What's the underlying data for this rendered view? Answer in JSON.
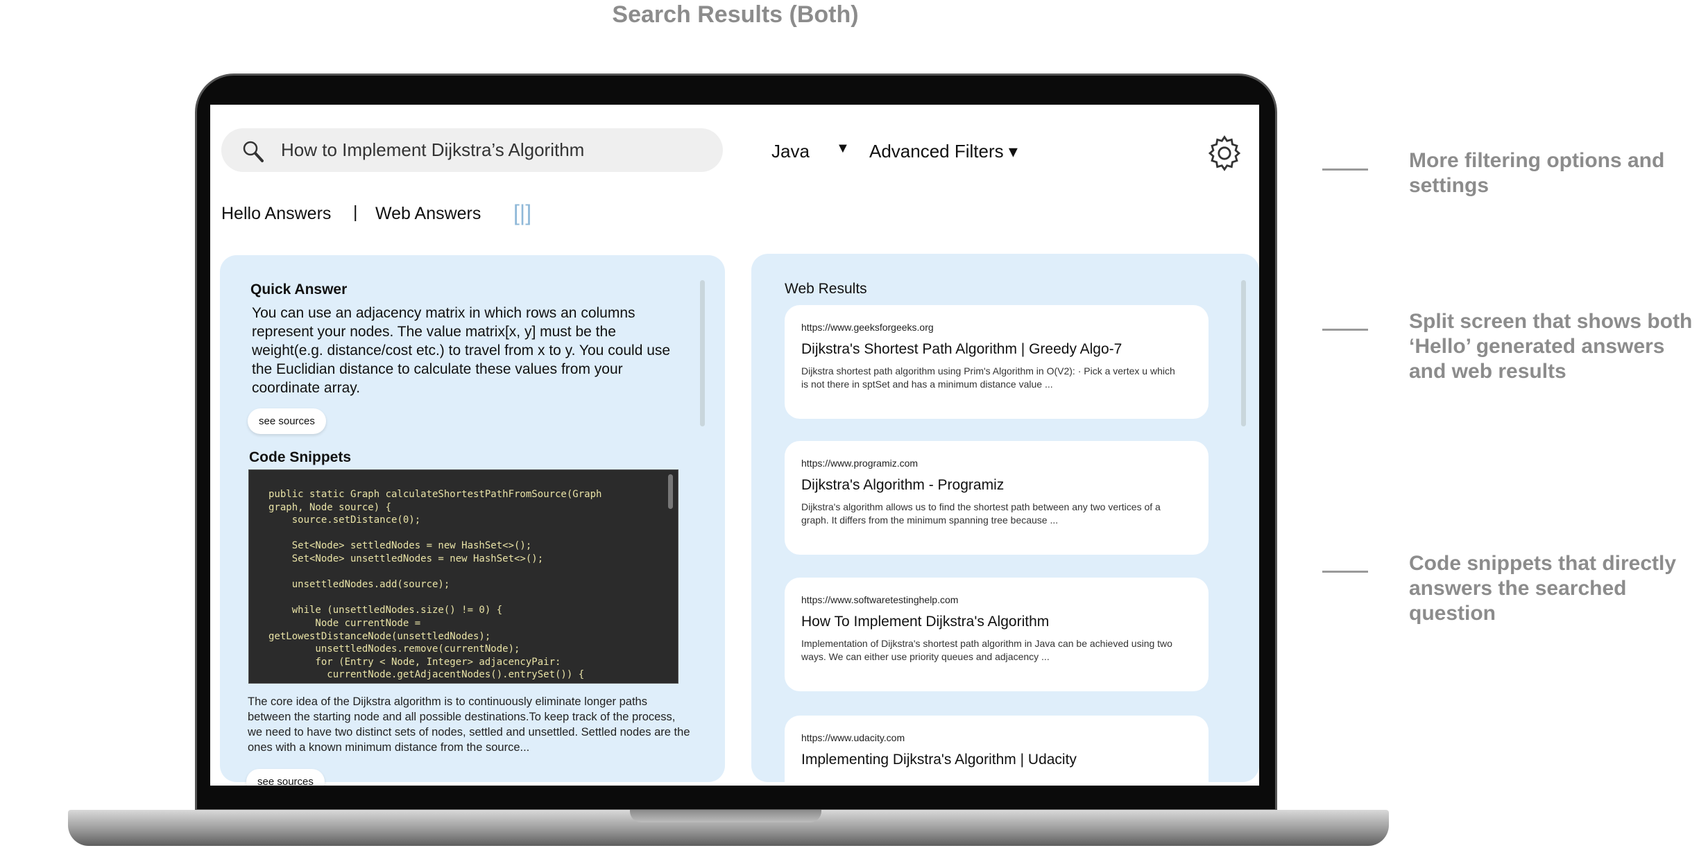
{
  "page_title": "Search Results (Both)",
  "search": {
    "query": "How to Implement Dijkstra’s Algorithm"
  },
  "filters": {
    "language": "Java",
    "advanced": "Advanced Filters ▾"
  },
  "tabs": {
    "hello": "Hello Answers",
    "separator": "|",
    "web": "Web Answers",
    "split_icon": "[|]"
  },
  "left": {
    "quick_answer_heading": "Quick Answer",
    "quick_answer": "You can use an adjacency matrix in which rows an columns represent your nodes. The value matrix[x, y] must be the weight(e.g. distance/cost etc.) to travel from x to y. You could use the Euclidian distance to calculate these values from your coordinate array.",
    "see_sources": "see sources",
    "code_heading": "Code Snippets",
    "code": "public static Graph calculateShortestPathFromSource(Graph\ngraph, Node source) {\n    source.setDistance(0);\n\n    Set<Node> settledNodes = new HashSet<>();\n    Set<Node> unsettledNodes = new HashSet<>();\n\n    unsettledNodes.add(source);\n\n    while (unsettledNodes.size() != 0) {\n        Node currentNode =\ngetLowestDistanceNode(unsettledNodes);\n        unsettledNodes.remove(currentNode);\n        for (Entry < Node, Integer> adjacencyPair:\n          currentNode.getAdjacentNodes().entrySet()) {",
    "code_explanation": "The core idea of the Dijkstra algorithm is to continuously eliminate longer paths between the starting node and all possible destinations.To keep track of the process, we need to have two distinct sets of nodes, settled and unsettled. Settled nodes are the ones with a known minimum distance from the source...",
    "see_sources_2": "see sources"
  },
  "right": {
    "heading": "Web Results",
    "results": [
      {
        "url": "https://www.geeksforgeeks.org",
        "title": "Dijkstra's Shortest Path Algorithm | Greedy Algo-7",
        "desc": "Dijkstra shortest path algorithm using Prim's Algorithm in O(V2): · Pick a vertex u which is not there in sptSet and has a minimum distance value ..."
      },
      {
        "url": "https://www.programiz.com",
        "title": "Dijkstra's Algorithm - Programiz",
        "desc": "Dijkstra's algorithm allows us to find the shortest path between any two vertices of a graph. It differs from the minimum spanning tree because ..."
      },
      {
        "url": "https://www.softwaretestinghelp.com",
        "title": "How To Implement Dijkstra's Algorithm",
        "desc": "Implementation of Dijkstra's shortest path algorithm in Java can be achieved using two ways. We can either use priority queues and adjacency ..."
      },
      {
        "url": "https://www.udacity.com",
        "title": "Implementing Dijkstra's Algorithm | Udacity",
        "desc": ""
      }
    ]
  },
  "annotations": [
    "More filtering options and settings",
    "Split screen that shows both ‘Hello’ generated answers and web results",
    "Code snippets that directly answers the searched question"
  ],
  "colors": {
    "panel": "#dfeefa",
    "code_bg": "#2b2b2b",
    "code_text": "#e9e3a6",
    "split_icon": "#8fb8d8",
    "annotation": "#8c8c8c"
  }
}
